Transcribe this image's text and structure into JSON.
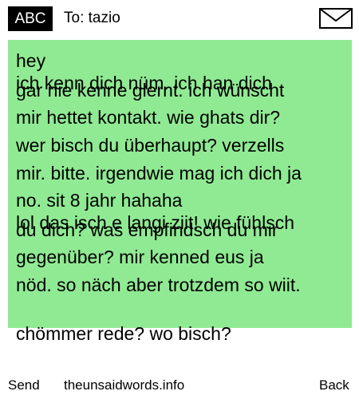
{
  "header": {
    "input_mode": "ABC",
    "recipient": "To: tazio",
    "envelope_icon": "envelope-icon"
  },
  "message": {
    "background_color": "#90ea93",
    "lines": [
      "hey",
      "ich kenn dich nüm. ich han dich",
      "gar nie kenne glernt. ich wünscht",
      "mir hettet kontakt. wie ghats dir?",
      "wer bisch du überhaupt? verzells",
      "mir. bitte. irgendwie mag ich dich ja",
      "no. sit 8 jahr hahaha",
      "lol das isch e langi ziit! wie fühlsch",
      "du dich? was empfindsch du mir",
      "gegenüber? mir kenned eus ja",
      "nöd. so näch aber trotzdem so wiit.",
      "chömmer rede? wo bisch?"
    ]
  },
  "footer": {
    "send_label": "Send",
    "site_label": "theunsaidwords.info",
    "back_label": "Back"
  }
}
